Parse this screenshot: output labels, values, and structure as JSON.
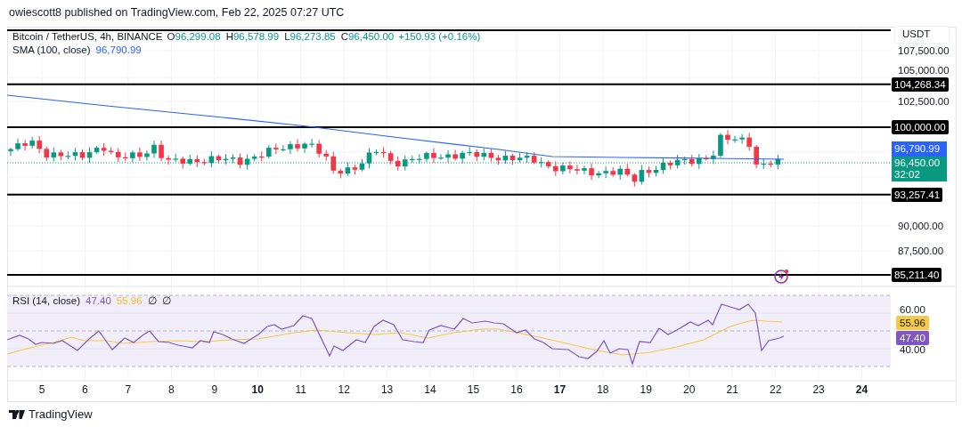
{
  "header": {
    "publisher": "owiescott8 published on TradingView.com, Feb 22, 2025 07:27 UTC"
  },
  "symbol_legend": {
    "title": "Bitcoin / TetherUS, 4h, BINANCE",
    "values": [
      {
        "label": "O",
        "value": "96,299.08"
      },
      {
        "label": "H",
        "value": "96,578.99"
      },
      {
        "label": "L",
        "value": "96,273.85"
      },
      {
        "label": "C",
        "value": "96,450.00"
      }
    ],
    "change": "+150.93 (+0.16%)"
  },
  "sma_legend": {
    "title": "SMA (100, close)",
    "value": "96,790.99"
  },
  "currency_button": "USDT",
  "price_axis": {
    "ticks": [
      "107,500.00",
      "105,000.00",
      "102,500.00",
      "90,000.00",
      "87,500.00"
    ]
  },
  "levels": [
    {
      "label": "104,268.34"
    },
    {
      "label": "100,000.00"
    },
    {
      "label": "93,257.41"
    },
    {
      "label": "85,211.40"
    }
  ],
  "sma_label": "96,790.99",
  "price_label": {
    "price": "96,450.00",
    "countdown": "32:02"
  },
  "rsi_legend": {
    "title": "RSI (14, close)",
    "rsi": "47.40",
    "ma": "55.96",
    "extras": [
      "∅",
      "∅"
    ]
  },
  "rsi_axis": {
    "ticks": [
      "60.00",
      "40.00"
    ]
  },
  "rsi_labels": {
    "ma": "55.96",
    "rsi": "47.40"
  },
  "time_axis": [
    {
      "label": "5",
      "bold": false
    },
    {
      "label": "6",
      "bold": false
    },
    {
      "label": "7",
      "bold": false
    },
    {
      "label": "8",
      "bold": false
    },
    {
      "label": "9",
      "bold": false
    },
    {
      "label": "10",
      "bold": true
    },
    {
      "label": "11",
      "bold": false
    },
    {
      "label": "12",
      "bold": false
    },
    {
      "label": "13",
      "bold": false
    },
    {
      "label": "14",
      "bold": false
    },
    {
      "label": "15",
      "bold": false
    },
    {
      "label": "16",
      "bold": false
    },
    {
      "label": "17",
      "bold": true
    },
    {
      "label": "18",
      "bold": false
    },
    {
      "label": "19",
      "bold": false
    },
    {
      "label": "20",
      "bold": false
    },
    {
      "label": "21",
      "bold": false
    },
    {
      "label": "22",
      "bold": false
    },
    {
      "label": "23",
      "bold": false
    },
    {
      "label": "24",
      "bold": true
    }
  ],
  "footer": {
    "logo_text": "TradingView"
  }
}
